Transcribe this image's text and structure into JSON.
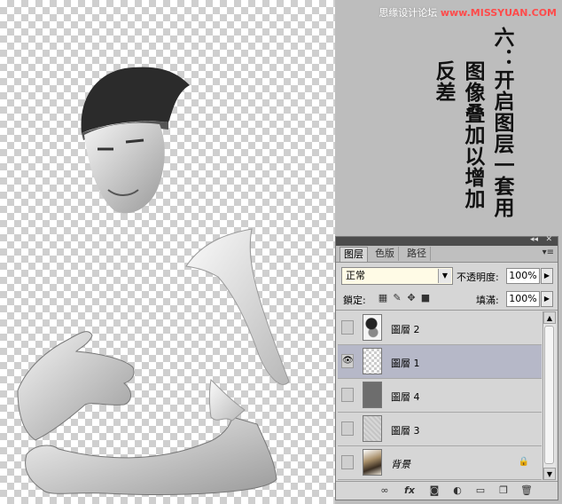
{
  "watermark": {
    "text_cn": "思缘设计论坛",
    "site": "www.MISSYUAN.COM"
  },
  "heading": {
    "column1": "六：开启图层一套用",
    "column2": "图像叠加以增加",
    "column3": "反差"
  },
  "panel": {
    "tabs": [
      {
        "label": "图层"
      },
      {
        "label": "色版"
      },
      {
        "label": "路径"
      }
    ],
    "blend_mode": "正常",
    "opacity_label": "不透明度:",
    "opacity_value": "100%",
    "lock_label": "鎖定:",
    "fill_label": "填滿:",
    "fill_value": "100%",
    "layers": [
      {
        "name": "圖層 2",
        "visible": false,
        "selected": false
      },
      {
        "name": "圖層 1",
        "visible": true,
        "selected": true
      },
      {
        "name": "圖層 4",
        "visible": false,
        "selected": false
      },
      {
        "name": "圖層 3",
        "visible": false,
        "selected": false
      },
      {
        "name": "背景",
        "visible": false,
        "selected": false,
        "locked": true
      }
    ],
    "footer_icons": [
      "link-icon",
      "fx-icon",
      "mask-icon",
      "adjustment-icon",
      "folder-icon",
      "new-layer-icon",
      "trash-icon"
    ]
  }
}
